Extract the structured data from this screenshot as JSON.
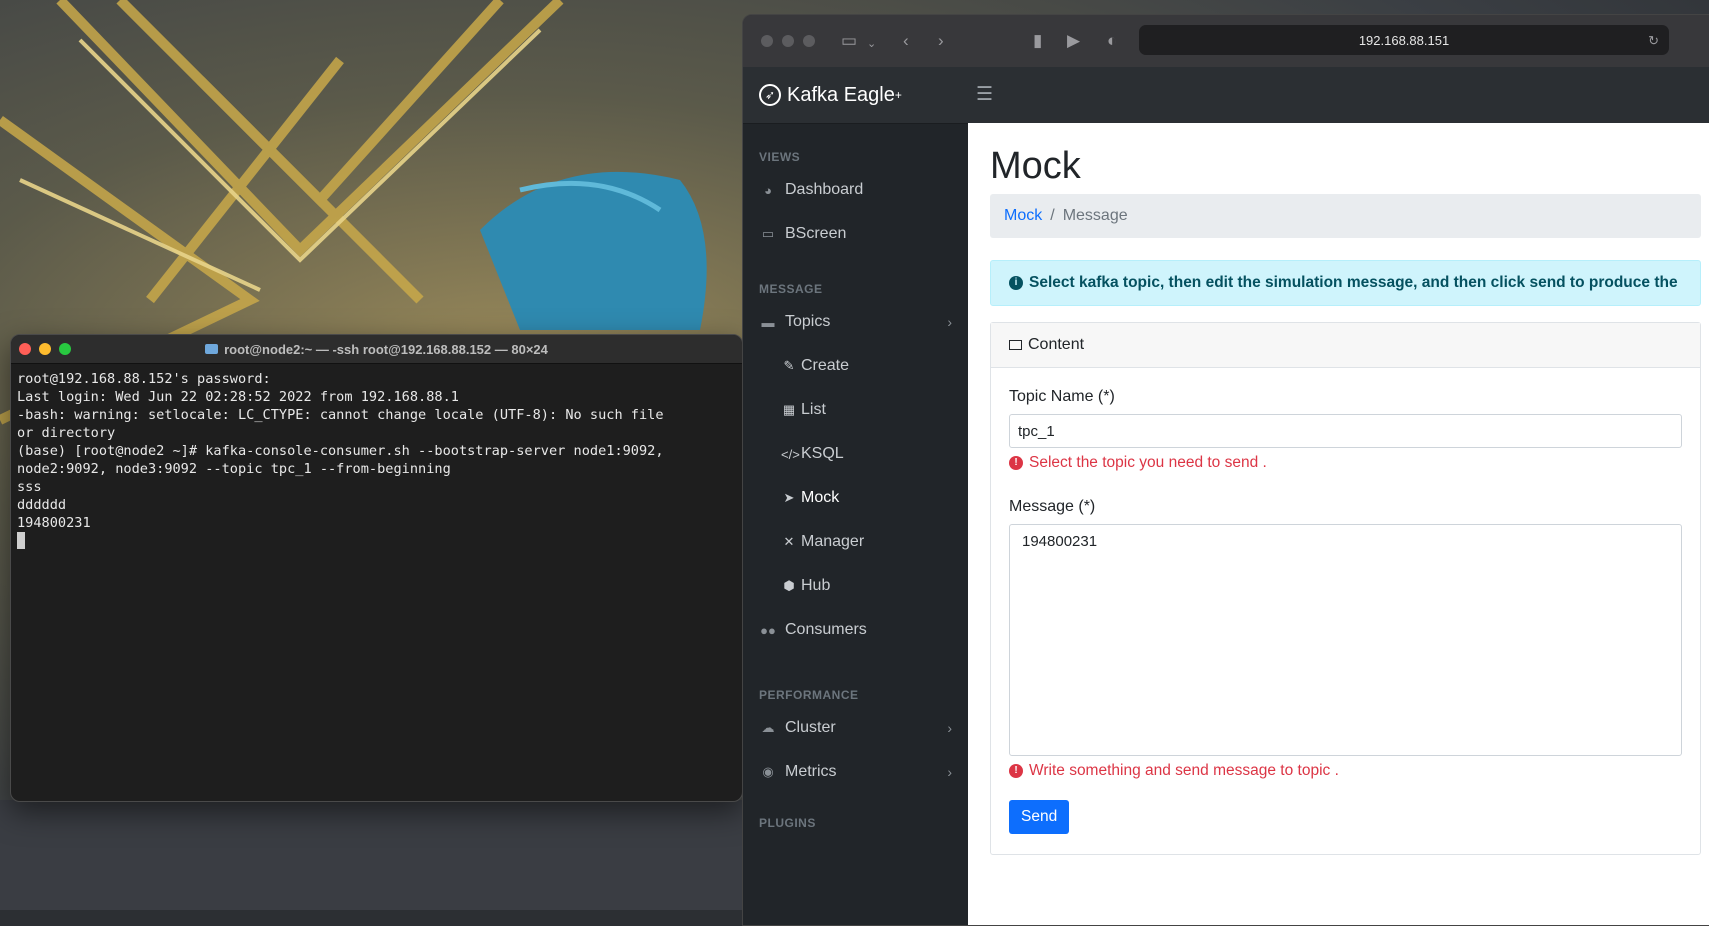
{
  "terminal": {
    "title": "root@node2:~ — -ssh root@192.168.88.152 — 80×24",
    "lines": [
      "root@192.168.88.152's password:",
      "Last login: Wed Jun 22 02:28:52 2022 from 192.168.88.1",
      "-bash: warning: setlocale: LC_CTYPE: cannot change locale (UTF-8): No such file",
      "or directory",
      "(base) [root@node2 ~]# kafka-console-consumer.sh --bootstrap-server node1:9092,",
      "node2:9092, node3:9092 --topic tpc_1 --from-beginning",
      "sss",
      "dddddd",
      "194800231"
    ]
  },
  "browser": {
    "url": "192.168.88.151"
  },
  "app": {
    "brand": "Kafka Eagle",
    "brand_sup": "+",
    "sidebar": {
      "sections": {
        "views": "VIEWS",
        "message": "MESSAGE",
        "performance": "PERFORMANCE",
        "plugins": "PLUGINS"
      },
      "items": {
        "dashboard": "Dashboard",
        "bscreen": "BScreen",
        "topics": "Topics",
        "create": "Create",
        "list": "List",
        "ksql": "KSQL",
        "mock": "Mock",
        "manager": "Manager",
        "hub": "Hub",
        "consumers": "Consumers",
        "cluster": "Cluster",
        "metrics": "Metrics"
      }
    },
    "page": {
      "title": "Mock",
      "breadcrumb": [
        "Mock",
        "Message"
      ],
      "alert": "Select kafka topic, then edit the simulation message, and then click send to produce the",
      "card_header": "Content",
      "topic_label": "Topic Name (*)",
      "topic_value": "tpc_1",
      "topic_help": "Select the topic you need to send .",
      "message_label": "Message (*)",
      "message_value": "194800231",
      "message_help": "Write something and send message to topic .",
      "send_label": "Send"
    }
  }
}
